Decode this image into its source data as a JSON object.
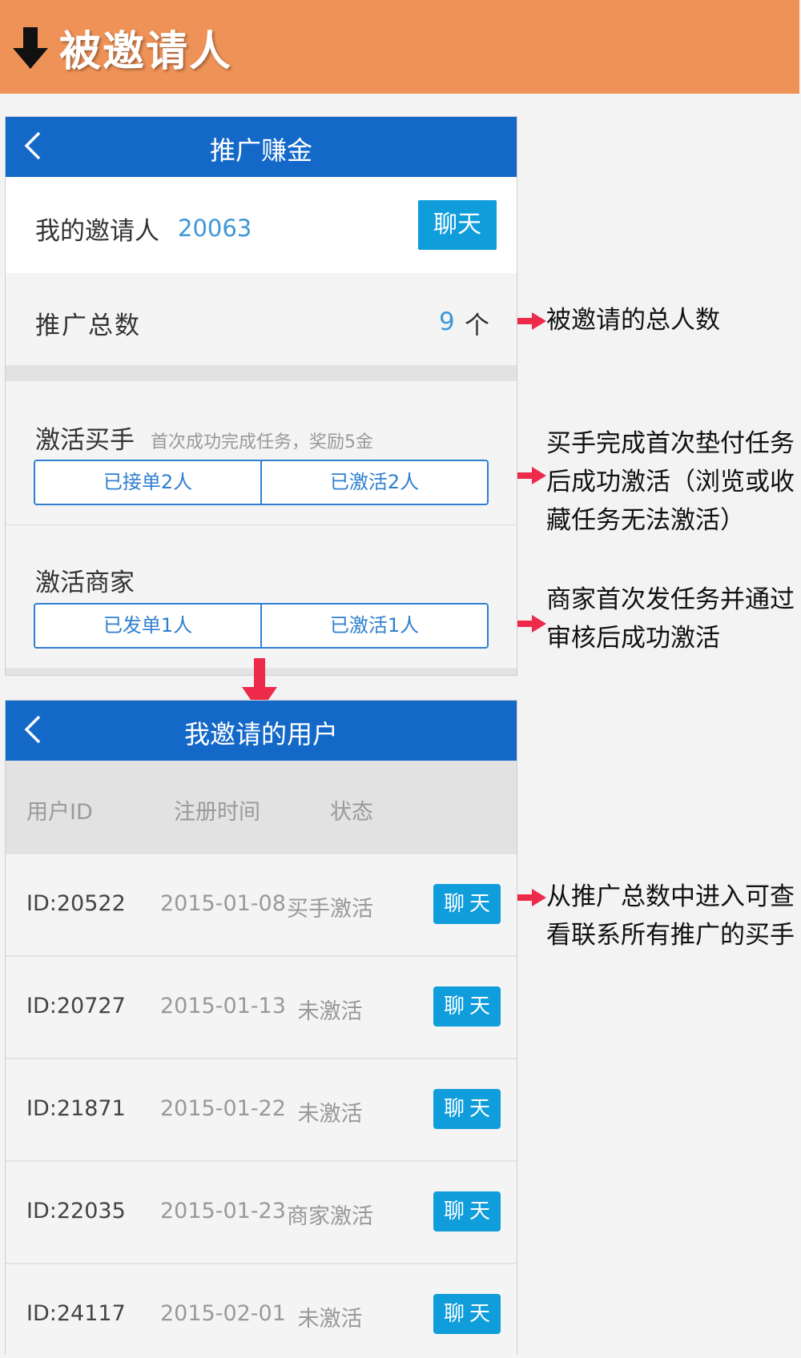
{
  "banner": {
    "title": "被邀请人",
    "icon": "arrow-down-icon",
    "color": "#ef9257"
  },
  "screen1": {
    "title": "推广赚金",
    "inviter_label": "我的邀请人",
    "inviter_id": "20063",
    "chat_label": "聊天",
    "total_label": "推广总数",
    "total_value": "9",
    "total_unit": "个",
    "buyer_title": "激活买手",
    "buyer_note": "首次成功完成任务，奖励5金",
    "buyer_accepted": "已接单2人",
    "buyer_activated": "已激活2人",
    "merchant_title": "激活商家",
    "merchant_posted": "已发单1人",
    "merchant_activated": "已激活1人"
  },
  "screen2": {
    "title": "我邀请的用户",
    "headers": [
      "用户ID",
      "注册时间",
      "状态"
    ],
    "rows": [
      {
        "id": "ID:20522",
        "date": "2015-01-08",
        "status": "买手激活",
        "chat": "聊天"
      },
      {
        "id": "ID:20727",
        "date": "2015-01-13",
        "status": "未激活",
        "chat": "聊天"
      },
      {
        "id": "ID:21871",
        "date": "2015-01-22",
        "status": "未激活",
        "chat": "聊天"
      },
      {
        "id": "ID:22035",
        "date": "2015-01-23",
        "status": "商家激活",
        "chat": "聊天"
      },
      {
        "id": "ID:24117",
        "date": "2015-02-01",
        "status": "未激活",
        "chat": "聊天"
      }
    ]
  },
  "annotations": [
    {
      "lines": [
        "被邀请的总人数"
      ]
    },
    {
      "lines": [
        "买手完成首次垫付任务",
        "后成功激活（浏览或收",
        "藏任务无法激活）"
      ]
    },
    {
      "lines": [
        "商家首次发任务并通过",
        "审核后成功激活"
      ]
    },
    {
      "lines": [
        "从推广总数中进入可查",
        "看联系所有推广的买手"
      ]
    }
  ],
  "colors": {
    "navbar": "#1469c8",
    "chat_button": "#109ddb",
    "accent_blue": "#3e97d8",
    "arrow_red": "#ee2a4b"
  }
}
